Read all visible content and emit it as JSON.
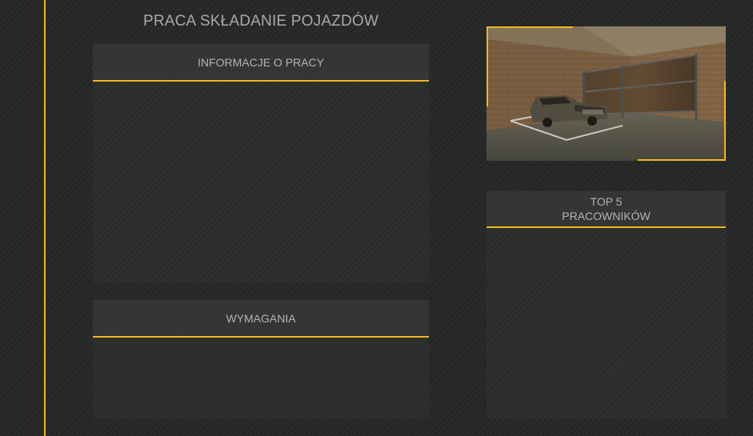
{
  "page": {
    "title": "PRACA SKŁADANIE POJAZDÓW"
  },
  "panels": {
    "info": {
      "title": "INFORMACJE O PRACY"
    },
    "requirements": {
      "title": "WYMAGANIA"
    },
    "top_workers": {
      "title_line1": "TOP 5",
      "title_line2": "PRACOWNIKÓW"
    }
  },
  "preview": {
    "subject": "garage-with-car-wreck-and-shelves"
  },
  "colors": {
    "accent": "#f2b61c",
    "background": "#252727",
    "panel": "#303232",
    "text": "#b3b3b3"
  }
}
